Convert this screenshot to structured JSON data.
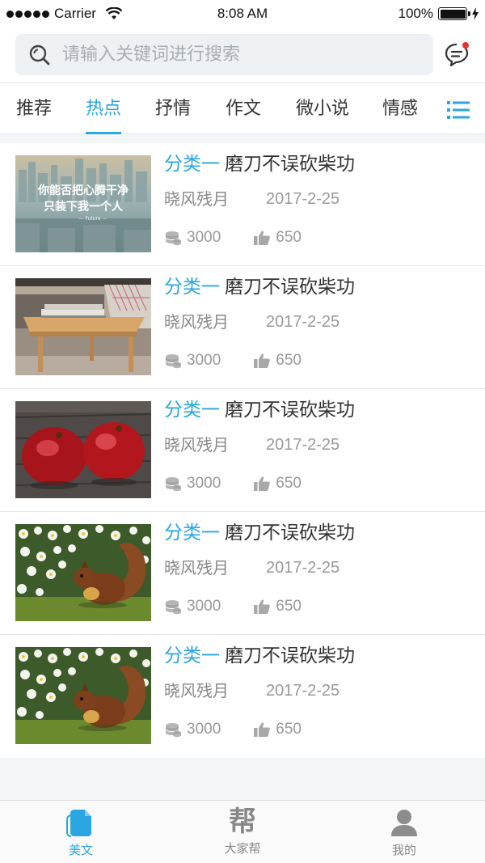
{
  "status_bar": {
    "carrier": "Carrier",
    "time": "8:08 AM",
    "battery": "100%",
    "battery_level": 1.0,
    "signal_icon": "signal-dots-icon",
    "wifi_icon": "wifi-icon",
    "battery_icon": "battery-icon"
  },
  "search": {
    "placeholder": "请输入关键词进行搜索",
    "value": "",
    "search_icon": "search-icon",
    "message_icon": "message-icon"
  },
  "tabs": [
    {
      "label": "推荐",
      "active": false
    },
    {
      "label": "热点",
      "active": true
    },
    {
      "label": "抒情",
      "active": false
    },
    {
      "label": "作文",
      "active": false
    },
    {
      "label": "微小说",
      "active": false
    },
    {
      "label": "情感",
      "active": false
    }
  ],
  "tab_menu_icon": "list-menu-icon",
  "articles": [
    {
      "category": "分类一",
      "title": "磨刀不误砍柴功",
      "author": "晓风残月",
      "date": "2017-2-25",
      "coins": "3000",
      "likes": "650",
      "thumb_text_1": "你能否把心腾干净",
      "thumb_text_2": "只装下我一个人",
      "thumb_text_3": "— Future —"
    },
    {
      "category": "分类一",
      "title": "磨刀不误砍柴功",
      "author": "晓风残月",
      "date": "2017-2-25",
      "coins": "3000",
      "likes": "650"
    },
    {
      "category": "分类一",
      "title": "磨刀不误砍柴功",
      "author": "晓风残月",
      "date": "2017-2-25",
      "coins": "3000",
      "likes": "650"
    },
    {
      "category": "分类一",
      "title": "磨刀不误砍柴功",
      "author": "晓风残月",
      "date": "2017-2-25",
      "coins": "3000",
      "likes": "650"
    },
    {
      "category": "分类一",
      "title": "磨刀不误砍柴功",
      "author": "晓风残月",
      "date": "2017-2-25",
      "coins": "3000",
      "likes": "650"
    }
  ],
  "stat_icons": {
    "coins": "coins-icon",
    "likes": "thumbs-up-icon"
  },
  "bottom_nav": [
    {
      "label": "美文",
      "icon": "document-icon",
      "active": true
    },
    {
      "label": "大家帮",
      "icon": "bang-icon",
      "glyph": "帮",
      "active": false
    },
    {
      "label": "我的",
      "icon": "user-icon",
      "active": false
    }
  ],
  "colors": {
    "accent": "#2aa6e0",
    "notification_dot": "#e8322d",
    "text": "#333333",
    "muted": "#999999"
  }
}
